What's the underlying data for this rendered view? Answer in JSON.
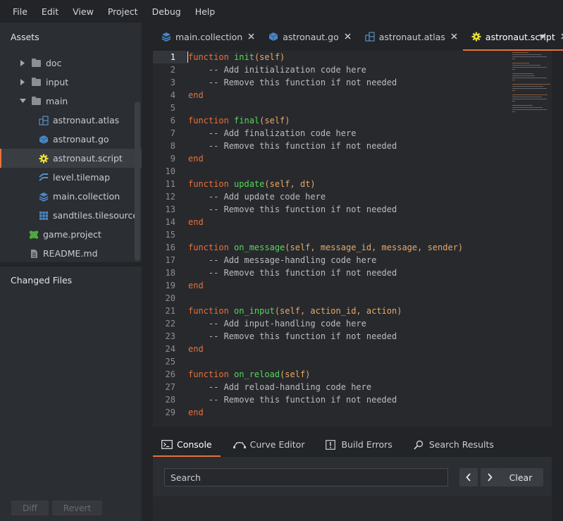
{
  "menu": [
    "File",
    "Edit",
    "View",
    "Project",
    "Debug",
    "Help"
  ],
  "assets_panel": {
    "title": "Assets",
    "items": [
      {
        "label": "doc",
        "type": "folder",
        "depth": 0,
        "expanded": false
      },
      {
        "label": "input",
        "type": "folder",
        "depth": 0,
        "expanded": false
      },
      {
        "label": "main",
        "type": "folder",
        "depth": 0,
        "expanded": true
      },
      {
        "label": "astronaut.atlas",
        "type": "atlas",
        "depth": 1
      },
      {
        "label": "astronaut.go",
        "type": "go",
        "depth": 1
      },
      {
        "label": "astronaut.script",
        "type": "script",
        "depth": 1,
        "selected": true
      },
      {
        "label": "level.tilemap",
        "type": "tilemap",
        "depth": 1
      },
      {
        "label": "main.collection",
        "type": "collection",
        "depth": 1
      },
      {
        "label": "sandtiles.tilesource",
        "type": "tilesource",
        "depth": 1
      },
      {
        "label": "game.project",
        "type": "project",
        "depth": 0
      },
      {
        "label": "README.md",
        "type": "file",
        "depth": 0
      }
    ]
  },
  "changed_files": {
    "title": "Changed Files",
    "diff_label": "Diff",
    "revert_label": "Revert"
  },
  "editor_tabs": [
    {
      "label": "main.collection",
      "icon": "collection-icon",
      "active": false
    },
    {
      "label": "astronaut.go",
      "icon": "cube-icon",
      "active": false
    },
    {
      "label": "astronaut.atlas",
      "icon": "atlas-icon",
      "active": false
    },
    {
      "label": "astronaut.script",
      "icon": "gear-icon",
      "active": true
    }
  ],
  "code_lines": [
    [
      [
        "kw",
        "function"
      ],
      [
        "t",
        " "
      ],
      [
        "fn",
        "init"
      ],
      [
        "pr",
        "(self)"
      ]
    ],
    [
      [
        "i",
        "    "
      ],
      [
        "cm",
        "-- Add initialization code here"
      ]
    ],
    [
      [
        "i",
        "    "
      ],
      [
        "cm",
        "-- Remove this function if not needed"
      ]
    ],
    [
      [
        "kw",
        "end"
      ]
    ],
    [],
    [
      [
        "kw",
        "function"
      ],
      [
        "t",
        " "
      ],
      [
        "fn",
        "final"
      ],
      [
        "pr",
        "(self)"
      ]
    ],
    [
      [
        "i",
        "    "
      ],
      [
        "cm",
        "-- Add finalization code here"
      ]
    ],
    [
      [
        "i",
        "    "
      ],
      [
        "cm",
        "-- Remove this function if not needed"
      ]
    ],
    [
      [
        "kw",
        "end"
      ]
    ],
    [],
    [
      [
        "kw",
        "function"
      ],
      [
        "t",
        " "
      ],
      [
        "fn",
        "update"
      ],
      [
        "pr",
        "(self, dt)"
      ]
    ],
    [
      [
        "i",
        "    "
      ],
      [
        "cm",
        "-- Add update code here"
      ]
    ],
    [
      [
        "i",
        "    "
      ],
      [
        "cm",
        "-- Remove this function if not needed"
      ]
    ],
    [
      [
        "kw",
        "end"
      ]
    ],
    [],
    [
      [
        "kw",
        "function"
      ],
      [
        "t",
        " "
      ],
      [
        "fn",
        "on_message"
      ],
      [
        "pr",
        "(self, message_id, message, sender)"
      ]
    ],
    [
      [
        "i",
        "    "
      ],
      [
        "cm",
        "-- Add message-handling code here"
      ]
    ],
    [
      [
        "i",
        "    "
      ],
      [
        "cm",
        "-- Remove this function if not needed"
      ]
    ],
    [
      [
        "kw",
        "end"
      ]
    ],
    [],
    [
      [
        "kw",
        "function"
      ],
      [
        "t",
        " "
      ],
      [
        "fn",
        "on_input"
      ],
      [
        "pr",
        "(self, action_id, action)"
      ]
    ],
    [
      [
        "i",
        "    "
      ],
      [
        "cm",
        "-- Add input-handling code here"
      ]
    ],
    [
      [
        "i",
        "    "
      ],
      [
        "cm",
        "-- Remove this function if not needed"
      ]
    ],
    [
      [
        "kw",
        "end"
      ]
    ],
    [],
    [
      [
        "kw",
        "function"
      ],
      [
        "t",
        " "
      ],
      [
        "fn",
        "on_reload"
      ],
      [
        "pr",
        "(self)"
      ]
    ],
    [
      [
        "i",
        "    "
      ],
      [
        "cm",
        "-- Add reload-handling code here"
      ]
    ],
    [
      [
        "i",
        "    "
      ],
      [
        "cm",
        "-- Remove this function if not needed"
      ]
    ],
    [
      [
        "kw",
        "end"
      ]
    ]
  ],
  "current_line": 1,
  "bottom_tabs": [
    {
      "label": "Console",
      "icon": "console-icon",
      "active": true
    },
    {
      "label": "Curve Editor",
      "icon": "curve-icon",
      "active": false
    },
    {
      "label": "Build Errors",
      "icon": "alert-icon",
      "active": false
    },
    {
      "label": "Search Results",
      "icon": "search-icon",
      "active": false
    }
  ],
  "console": {
    "search_placeholder": "Search",
    "prev_label": "<",
    "next_label": ">",
    "clear_label": "Clear"
  },
  "colors": {
    "accent": "#e8713a",
    "keyword": "#e8713a",
    "function_name": "#57d659",
    "params": "#e8a86a",
    "comment": "#b8bcc0"
  }
}
